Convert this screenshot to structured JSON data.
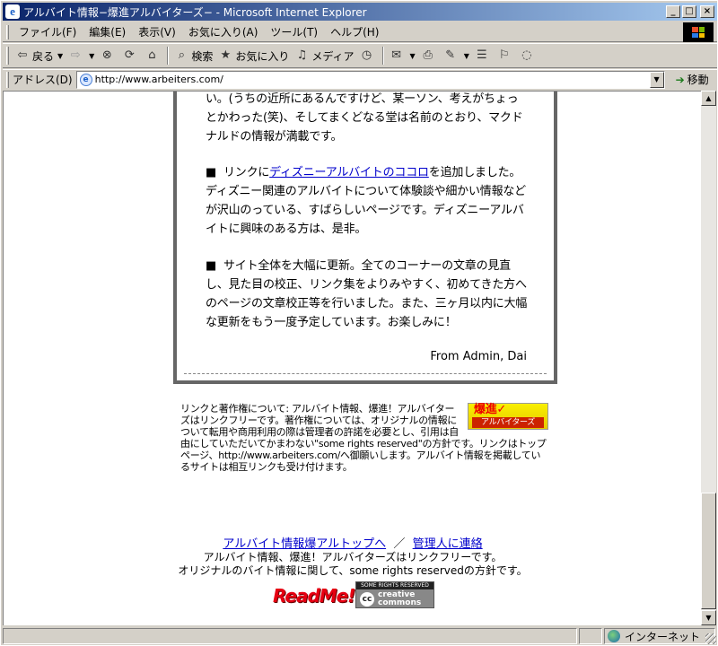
{
  "window": {
    "title": "アルバイト情報−爆進アルバイターズ− - Microsoft Internet Explorer",
    "minimize": "_",
    "maximize": "□",
    "close": "×"
  },
  "menu": [
    "ファイル(F)",
    "編集(E)",
    "表示(V)",
    "お気に入り(A)",
    "ツール(T)",
    "ヘルプ(H)"
  ],
  "toolbar": {
    "back": "戻る",
    "search": "検索",
    "favorites": "お気に入り",
    "media": "メディア"
  },
  "address": {
    "label": "アドレス(D)",
    "url": "http://www.arbeiters.com/",
    "go": "移動"
  },
  "content": {
    "para1": "い。(うちの近所にあるんですけど、某ーソン、考えがちょっとかわった(笑)、そしてまくどなる堂は名前のとおり、マクドナルドの情報が満載です。",
    "para2_bullet": "■",
    "para2_pre": "リンクに",
    "para2_link": "ディズニーアルバイトのココロ",
    "para2_post": "を追加しました。ディズニー関連のアルバイトについて体験談や細かい情報などが沢山のっている、すばらしいページです。ディズニーアルバイトに興味のある方は、是非。",
    "para3_bullet": "■",
    "para3_text": "サイト全体を大幅に更新。全てのコーナーの文章の見直し、見た目の校正、リンク集をよりみやすく、初めてきた方へのページの文章校正等を行いました。また、三ヶ月以内に大幅な更新をもう一度予定しています。お楽しみに！",
    "signature": "From Admin, Dai"
  },
  "notice": {
    "text": "リンクと著作権について: アルバイト情報、爆進！アルバイターズはリンクフリーです。著作権については、オリジナルの情報について転用や商用利用の際は管理者の許諾を必要とし、引用は自由にしていただいてかまわない\"some rights reserved\"の方針です。リンクはトップページ、http://www.arbeiters.com/へ御願いします。アルバイト情報を掲載しているサイトは相互リンクも受け付けます。",
    "badge_top": "爆進✓",
    "badge_bottom": "アルバイターズ"
  },
  "footer": {
    "link_top": "アルバイト情報爆アルトップへ",
    "separator": "／",
    "link_admin": "管理人に連絡",
    "line1": "アルバイト情報、爆進！アルバイターズはリンクフリーです。",
    "line2": "オリジナルのバイト情報に関して、some rights reservedの方針です。",
    "readme": "ReadMe!",
    "cc_top": "SOME RIGHTS RESERVED",
    "cc_bottom_1": "creative",
    "cc_bottom_2": "commons",
    "cc_symbol": "cc"
  },
  "status": {
    "zone": "インターネット"
  }
}
